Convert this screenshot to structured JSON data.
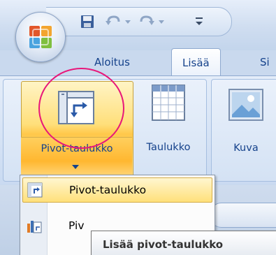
{
  "quick_access": {
    "save_icon": "save-icon",
    "undo_icon": "undo-icon",
    "redo_icon": "redo-icon",
    "customize_icon": "customize-qat-icon"
  },
  "tabs": [
    {
      "label": "Aloitus"
    },
    {
      "label": "Lisää",
      "active": true
    },
    {
      "label": "Si"
    }
  ],
  "ribbon": {
    "pivot_button_label": "Pivot-taulukko",
    "table_button_label": "Taulukko",
    "picture_button_label": "Kuva"
  },
  "menu": {
    "items": [
      {
        "label": "Pivot-taulukko",
        "icon": "pivot-table-icon",
        "highlighted": true
      },
      {
        "label": "Piv",
        "icon": "pivot-chart-icon",
        "highlighted": false
      }
    ]
  },
  "tooltip": {
    "text": "Lisää pivot-taulukko"
  },
  "colors": {
    "highlight_circle": "#e8177a",
    "hot_fill": "#ffd966",
    "ribbon_text": "#15428b"
  }
}
